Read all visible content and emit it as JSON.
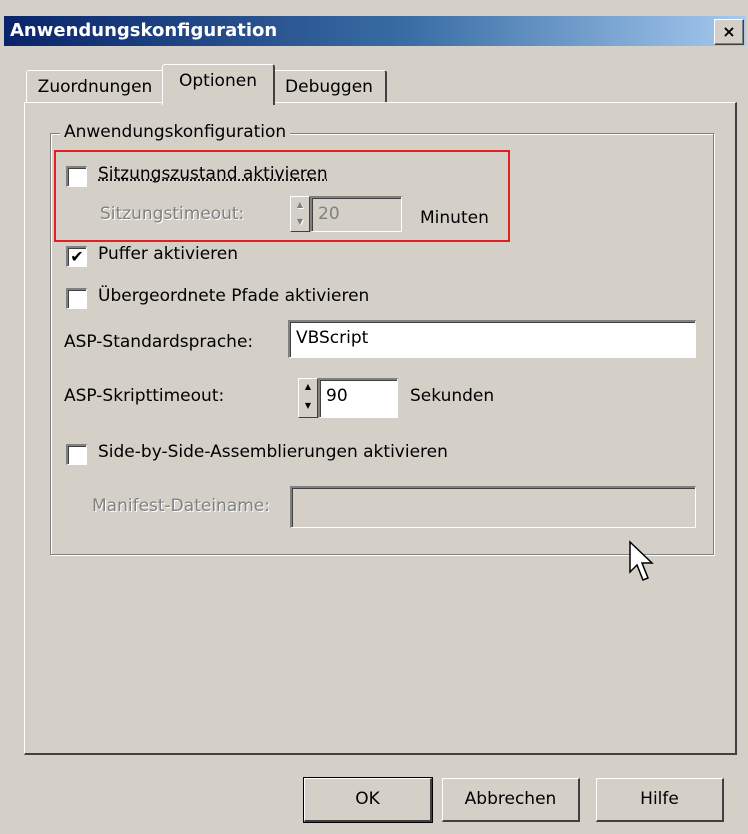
{
  "window": {
    "title": "Anwendungskonfiguration",
    "close_label": "×"
  },
  "tabs": [
    {
      "label": "Zuordnungen",
      "active": false
    },
    {
      "label": "Optionen",
      "active": true
    },
    {
      "label": "Debuggen",
      "active": false
    }
  ],
  "group": {
    "title": "Anwendungskonfiguration"
  },
  "options": {
    "session_state": {
      "label": "Sitzungszustand aktivieren",
      "checked": false
    },
    "session_timeout": {
      "label": "Sitzungstimeout:",
      "value": "20",
      "unit": "Minuten",
      "enabled": false
    },
    "buffer": {
      "label": "Puffer aktivieren",
      "checked": true,
      "check_glyph": "✔"
    },
    "parent_paths": {
      "label": "Übergeordnete Pfade aktivieren",
      "checked": false
    },
    "asp_language": {
      "label": "ASP-Standardsprache:",
      "value": "VBScript"
    },
    "asp_timeout": {
      "label": "ASP-Skripttimeout:",
      "value": "90",
      "unit": "Sekunden"
    },
    "side_by_side": {
      "label": "Side-by-Side-Assemblierungen aktivieren",
      "checked": false
    },
    "manifest": {
      "label": "Manifest-Dateiname:",
      "value": "",
      "enabled": false
    }
  },
  "buttons": {
    "ok": "OK",
    "cancel": "Abbrechen",
    "help": "Hilfe"
  },
  "spinner_glyphs": {
    "up": "▲",
    "down": "▼"
  },
  "highlight_color": "#e02020"
}
